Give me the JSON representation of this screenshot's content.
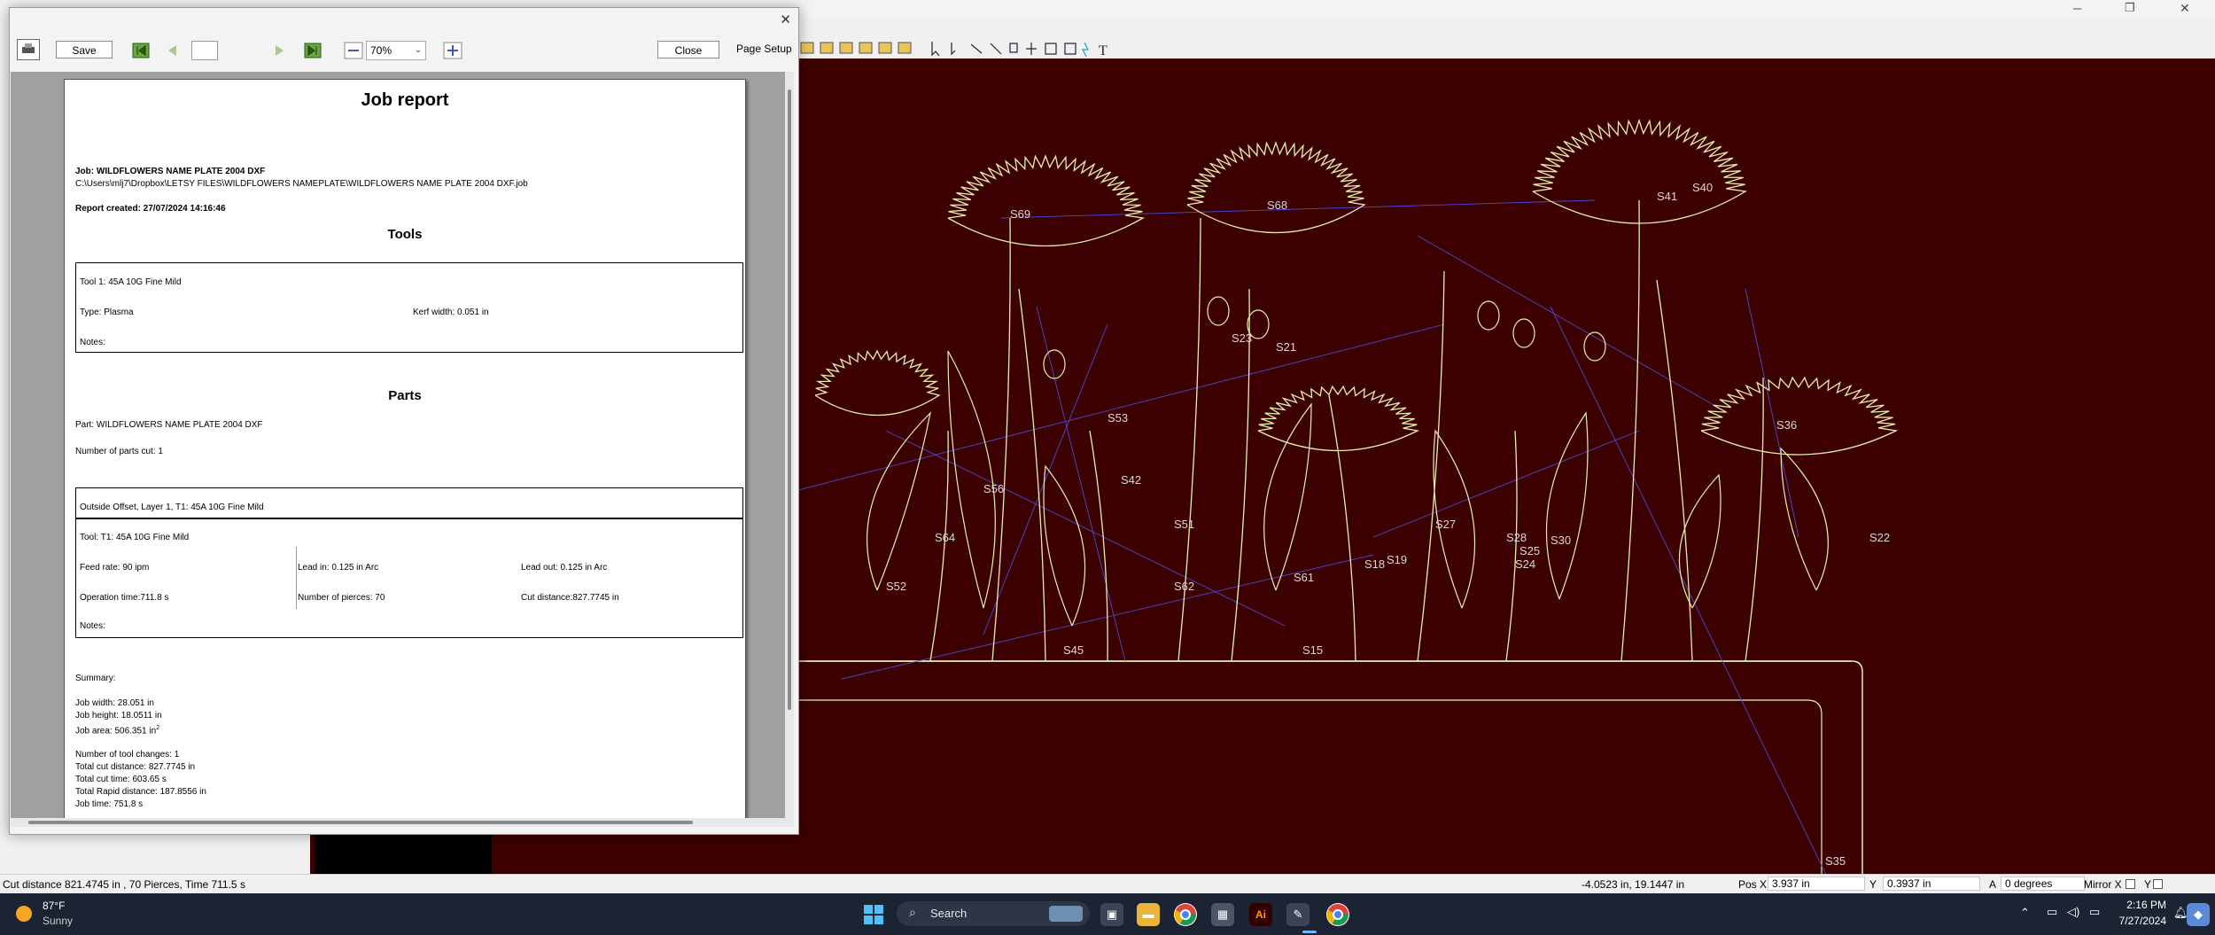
{
  "dialog": {
    "toolbar": {
      "save_label": "Save",
      "page_input": "",
      "zoom_value": "70%",
      "close_label": "Close",
      "page_setup_label": "Page Setup"
    }
  },
  "report": {
    "title": "Job report",
    "job_line": "Job: WILDFLOWERS NAME PLATE 2004 DXF",
    "path": "C:\\Users\\mlj7\\Dropbox\\LETSY FILES\\WILDFLOWERS NAMEPLATE\\WILDFLOWERS NAME PLATE 2004 DXF.job",
    "created": "Report created: 27/07/2024 14:16:46",
    "tools_heading": "Tools",
    "tool": {
      "name": "Tool 1: 45A 10G Fine Mild",
      "type": "Type: Plasma",
      "kerf": "Kerf width: 0.051 in",
      "notes": "Notes:"
    },
    "parts_heading": "Parts",
    "part_line": "Part: WILDFLOWERS NAME PLATE 2004 DXF",
    "parts_cut": "Number of parts cut: 1",
    "operation": {
      "header": "Outside Offset, Layer 1, T1: 45A 10G Fine Mild",
      "tool": "Tool: T1: 45A 10G Fine Mild",
      "feed": "Feed rate: 90 ipm",
      "lead_in": "Lead in: 0.125 in Arc",
      "lead_out": "Lead out: 0.125 in Arc",
      "op_time": "Operation time:711.8 s",
      "pierces": "Number of pierces: 70",
      "cut_dist": "Cut distance:827.7745 in",
      "notes": "Notes:"
    },
    "summary": {
      "heading": "Summary:",
      "width": "Job width: 28.051 in",
      "height": "Job height: 18.0511 in",
      "area": "Job area: 506.351 in",
      "area_sup": "2",
      "tool_changes": "Number of tool changes: 1",
      "total_cut_dist": "Total cut distance: 827.7745 in",
      "total_cut_time": "Total cut time: 603.65 s",
      "rapid": "Total Rapid distance: 187.8556 in",
      "job_time": "Job time: 751.8 s"
    }
  },
  "canvas": {
    "labels": [
      "S69",
      "S68",
      "S40",
      "S41",
      "S53",
      "S36",
      "S56",
      "S42",
      "S51",
      "S64",
      "S27",
      "S28",
      "S30",
      "S18",
      "S19",
      "S24",
      "S62",
      "S61",
      "S25",
      "S45",
      "S15",
      "S35",
      "S52",
      "S23",
      "S22",
      "S21"
    ]
  },
  "status": {
    "cut_info": "Cut distance 821.4745 in , 70 Pierces, Time 711.5 s",
    "cursor": "-4.0523 in, 19.1447 in",
    "pos_x_label": "Pos X",
    "pos_x": "3.937 in",
    "y_label": "Y",
    "pos_y": "0.3937 in",
    "a_label": "A",
    "angle": "0 degrees",
    "mirror_x": "Mirror X",
    "mirror_y": "Y"
  },
  "taskbar": {
    "temp": "87°F",
    "weather": "Sunny",
    "search": "Search",
    "time": "2:16 PM",
    "date": "7/27/2024"
  },
  "colors": {
    "canvas_bg": "#3d0000",
    "outline": "#e8f0b0",
    "rapid": "#4a4ad8"
  }
}
